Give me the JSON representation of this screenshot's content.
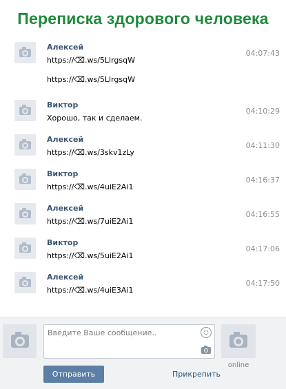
{
  "title": "Переписка здорового человека",
  "messages": [
    {
      "author": "Алексей",
      "time": "04:07:43",
      "text": "https://⌫.ws/5LlrgsqW",
      "text2": "https://⌫.ws/5LlrgsqW"
    },
    {
      "author": "Виктор",
      "time": "04:10:29",
      "text": "Хорошо, так и сделаем."
    },
    {
      "author": "Алексей",
      "time": "04:11:30",
      "text": "https://⌫.ws/3skv1zLy"
    },
    {
      "author": "Виктор",
      "time": "04:16:37",
      "text": "https://⌫.ws/4uiE2Ai1"
    },
    {
      "author": "Алексей",
      "time": "04:16:55",
      "text": "https://⌫.ws/7uiE2Ai1"
    },
    {
      "author": "Виктор",
      "time": "04:17:06",
      "text": "https://⌫.ws/5uiE2Ai1"
    },
    {
      "author": "Алексей",
      "time": "04:17:50",
      "text": "https://⌫.ws/4uiE3Ai1"
    }
  ],
  "composer": {
    "placeholder": "Введите Ваше сообщение..",
    "send_label": "Отправить",
    "attach_label": "Прикрепить",
    "status_label": "online"
  },
  "icons": {
    "avatar": "camera-icon",
    "emoji": "smiley-icon",
    "attach_photo": "camera-icon"
  },
  "colors": {
    "title": "#1f8a3b",
    "author": "#3b5775",
    "send_button": "#5b7fa6",
    "link": "#2b587a"
  }
}
